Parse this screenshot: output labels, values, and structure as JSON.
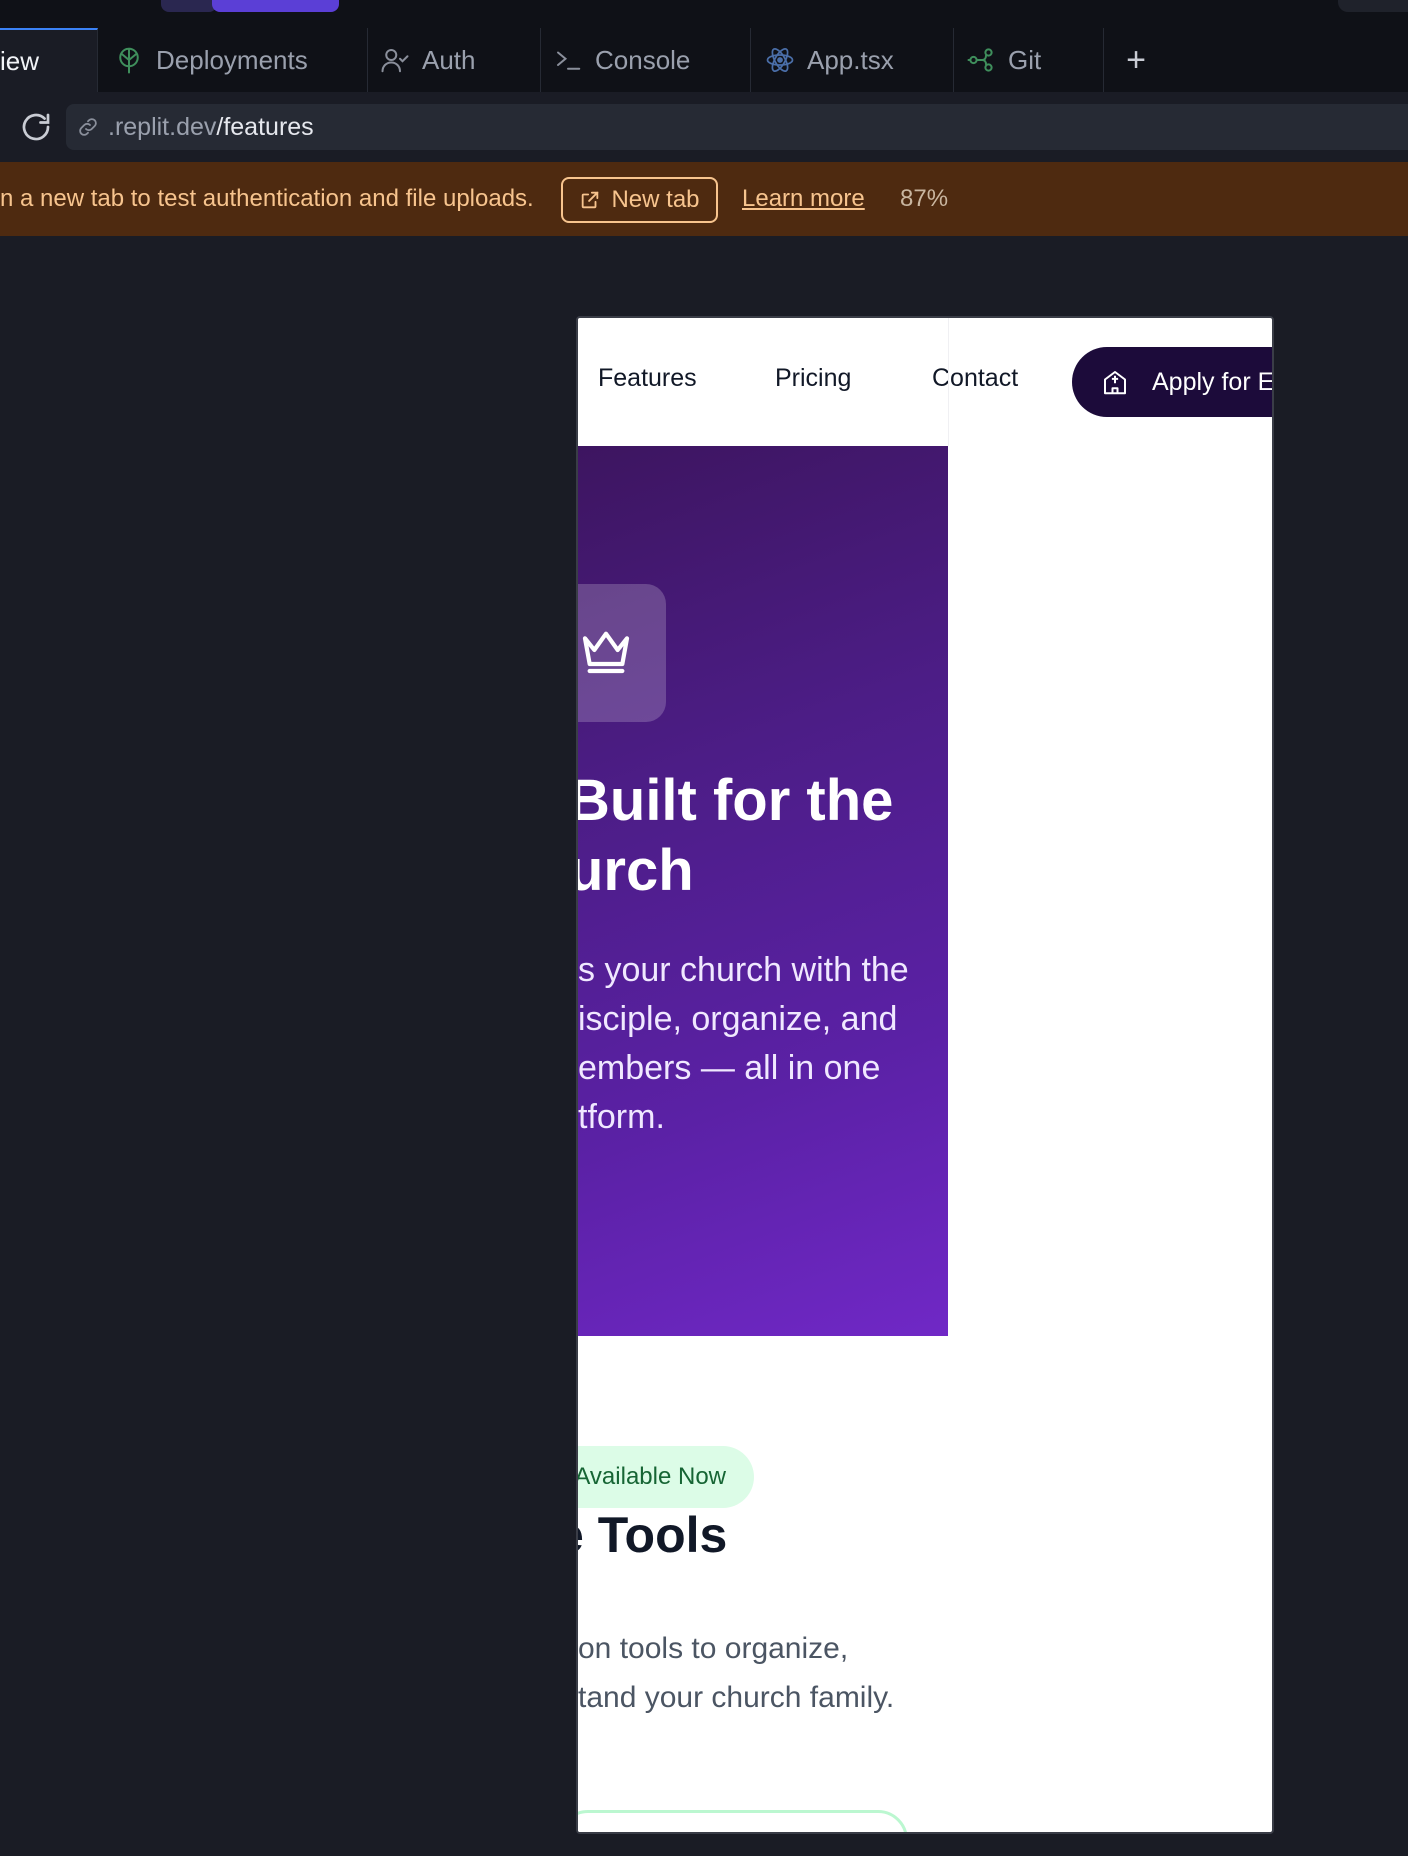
{
  "tabs": [
    {
      "label": "iew",
      "icon": "preview-icon",
      "active": true
    },
    {
      "label": "Deployments",
      "icon": "deployments-icon",
      "active": false
    },
    {
      "label": "Auth",
      "icon": "auth-user-icon",
      "active": false
    },
    {
      "label": "Console",
      "icon": "terminal-icon",
      "active": false
    },
    {
      "label": "App.tsx",
      "icon": "react-icon",
      "active": false
    },
    {
      "label": "Git",
      "icon": "git-icon",
      "active": false
    }
  ],
  "address_bar": {
    "host": ".replit.dev",
    "path": "/features"
  },
  "banner": {
    "message": "n a new tab to test authentication and file uploads.",
    "new_tab_label": "New tab",
    "learn_more_label": "Learn more",
    "zoom": "87%"
  },
  "site": {
    "nav": {
      "features": "Features",
      "pricing": "Pricing",
      "contact": "Contact",
      "apply_label": "Apply for E"
    },
    "hero": {
      "title_line1": "Built for the",
      "title_line2": "urch",
      "desc_lines": [
        "s your church with the",
        "isciple, organize, and",
        "embers — all in one",
        "tform."
      ]
    },
    "section": {
      "badge": "Available Now",
      "title": "e Tools",
      "desc_line1": "on tools to organize,",
      "desc_line2": "tand your church family."
    }
  },
  "colors": {
    "banner_bg": "#4e2a10",
    "banner_text": "#f7c48e",
    "hero_gradient_start": "#3d1560",
    "hero_gradient_end": "#7028c6",
    "apply_button_bg": "#1c0b3a",
    "badge_bg": "#dcfce7",
    "badge_text": "#166534"
  }
}
